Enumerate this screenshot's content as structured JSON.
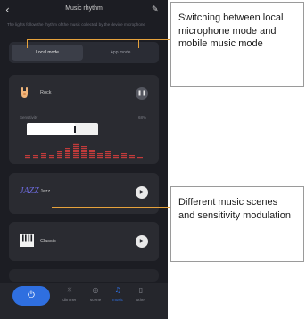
{
  "app": {
    "title": "Music rhythm",
    "subtitle": "The lights follow the rhythm of the music collected by the device microphone"
  },
  "modes": {
    "local": "Local mode",
    "app": "App mode"
  },
  "scenes": [
    {
      "name": "Rock",
      "icon": "rock-hand-icon",
      "state": "playing"
    },
    {
      "name": "Jazz",
      "icon": "jazz-text-icon",
      "icon_text": "JAZZ",
      "state": "stopped"
    },
    {
      "name": "Classic",
      "icon": "piano-icon",
      "state": "stopped"
    }
  ],
  "sensitivity": {
    "label": "Sensitivity",
    "value_text": "68%",
    "level": 0.68
  },
  "nav": {
    "items": [
      {
        "label": "dimmer",
        "icon": "sun-icon"
      },
      {
        "label": "scene",
        "icon": "scene-icon"
      },
      {
        "label": "music",
        "icon": "music-note-icon",
        "active": true
      },
      {
        "label": "other",
        "icon": "trash-icon"
      }
    ]
  },
  "annotations": {
    "top": "Switching between local microphone mode and mobile music mode",
    "bottom": "Different music scenes and sensitivity modulation"
  },
  "colors": {
    "screen_bg": "#1c1d23",
    "card_bg": "#2a2b31",
    "accent_blue": "#2f6fe0",
    "eq_red": "#c23b3b",
    "callout_line": "#e6a23c"
  }
}
